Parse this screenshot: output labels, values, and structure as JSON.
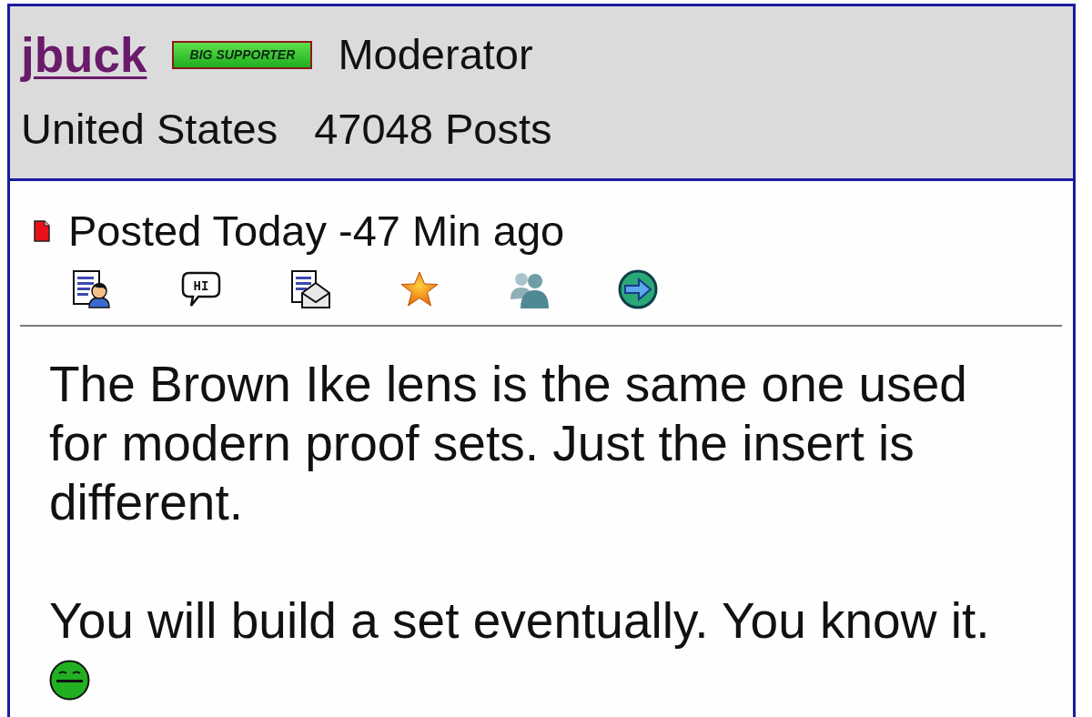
{
  "member": {
    "username": "jbuck",
    "badge": "BIG SUPPORTER",
    "role": "Moderator",
    "country": "United States",
    "post_count": "47048 Posts"
  },
  "post": {
    "posted": "Posted Today -47 Min ago",
    "actions": [
      {
        "kind": "profile"
      },
      {
        "kind": "greet",
        "label": "HI"
      },
      {
        "kind": "message"
      },
      {
        "kind": "favorite"
      },
      {
        "kind": "buddy"
      },
      {
        "kind": "website"
      }
    ],
    "paragraphs": [
      "The Brown Ike lens is the same one used for modern proof sets. Just the insert is different.",
      "You will build a set eventually. You know it."
    ]
  }
}
